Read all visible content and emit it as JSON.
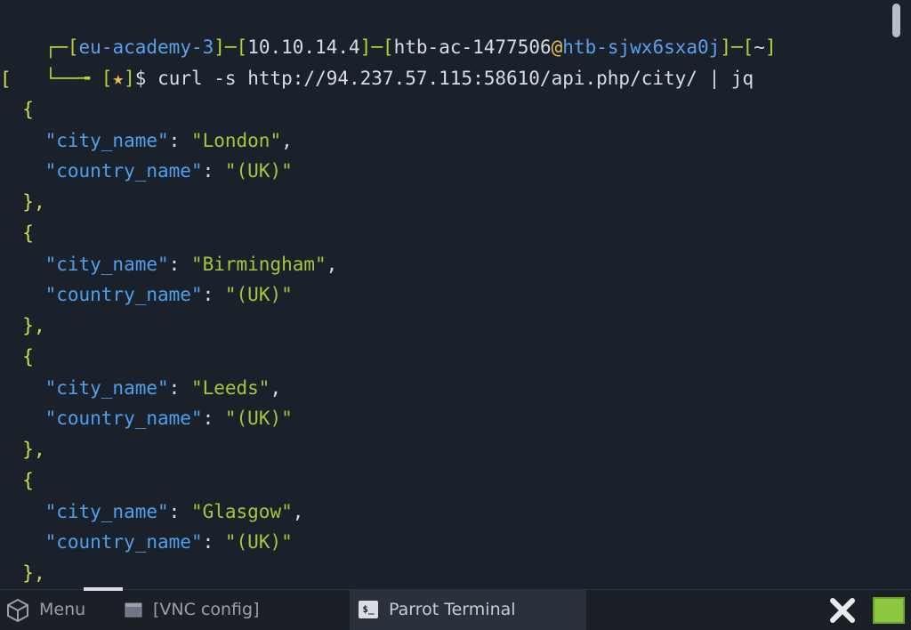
{
  "terminal": {
    "prompt": {
      "corner_top": "┌─",
      "corner_bottom": "└──╼ ",
      "lb": "[",
      "rb": "]",
      "dash": "─",
      "host_tag": "eu-academy-3",
      "ip": "10.10.14.4",
      "user": "htb-ac-1477506",
      "at": "@",
      "machine": "htb-sjwx6sxa0j",
      "cwd": "~",
      "star": "★",
      "dollar": "$ ",
      "command": "curl -s http://94.237.57.115:58610/api.php/city/ | jq"
    },
    "json": {
      "open_bracket": "[",
      "open_brace": "{",
      "close_brace": "},",
      "key_city": "\"city_name\"",
      "key_country": "\"country_name\"",
      "colon": ": ",
      "comma": ",",
      "records": [
        {
          "city": "\"London\"",
          "country": "\"(UK)\""
        },
        {
          "city": "\"Birmingham\"",
          "country": "\"(UK)\""
        },
        {
          "city": "\"Leeds\"",
          "country": "\"(UK)\""
        },
        {
          "city": "\"Glasgow\"",
          "country": "\"(UK)\""
        }
      ]
    }
  },
  "taskbar": {
    "menu_label": "Menu",
    "vnc_label": "[VNC config]",
    "terminal_label": "Parrot Terminal",
    "terminal_icon_text": "$_"
  }
}
